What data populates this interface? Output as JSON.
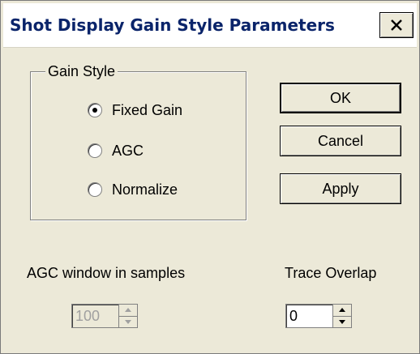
{
  "window": {
    "title": "Shot Display Gain Style Parameters",
    "close_icon": "close-icon"
  },
  "gain_style": {
    "label": "Gain Style",
    "options": [
      {
        "label": "Fixed Gain",
        "selected": true
      },
      {
        "label": "AGC",
        "selected": false
      },
      {
        "label": "Normalize",
        "selected": false
      }
    ]
  },
  "buttons": {
    "ok": "OK",
    "cancel": "Cancel",
    "apply": "Apply"
  },
  "agc_window": {
    "label": "AGC window in samples",
    "value": "100",
    "enabled": false
  },
  "trace_overlap": {
    "label": "Trace Overlap",
    "value": "0",
    "enabled": true
  }
}
